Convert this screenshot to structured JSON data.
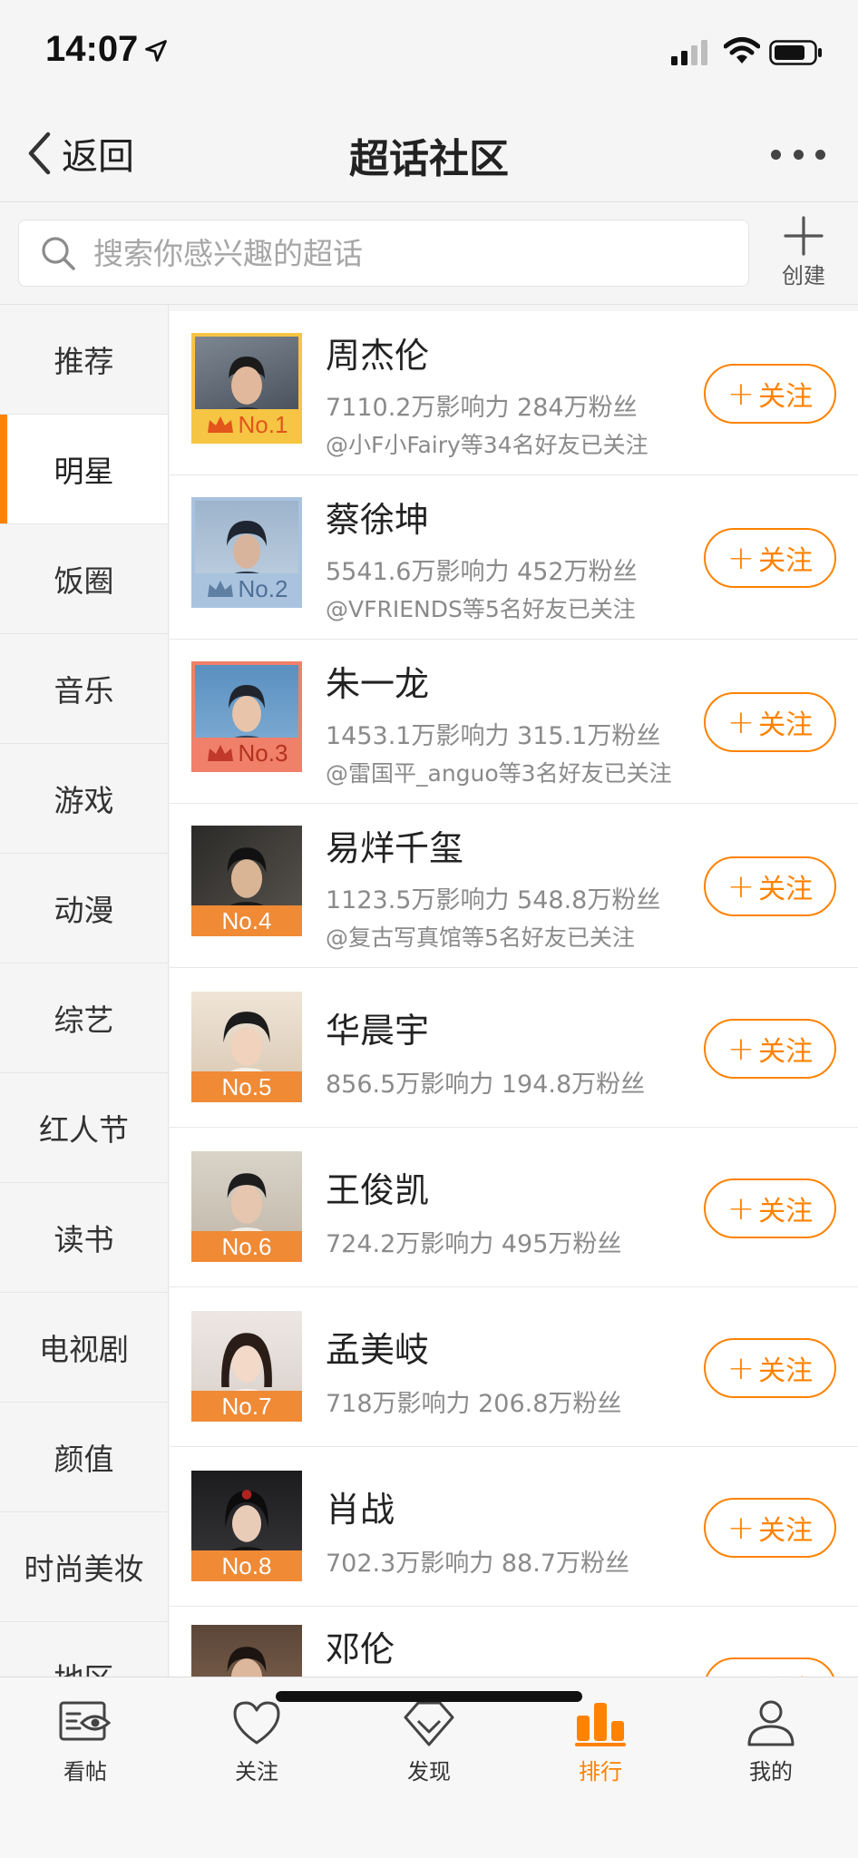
{
  "status_bar": {
    "time": "14:07"
  },
  "nav": {
    "back_label": "返回",
    "title": "超话社区"
  },
  "search": {
    "placeholder": "搜索你感兴趣的超话",
    "create_label": "创建"
  },
  "sidebar": {
    "items": [
      {
        "label": "推荐",
        "active": false
      },
      {
        "label": "明星",
        "active": true
      },
      {
        "label": "饭圈",
        "active": false
      },
      {
        "label": "音乐",
        "active": false
      },
      {
        "label": "游戏",
        "active": false
      },
      {
        "label": "动漫",
        "active": false
      },
      {
        "label": "综艺",
        "active": false
      },
      {
        "label": "红人节",
        "active": false
      },
      {
        "label": "读书",
        "active": false
      },
      {
        "label": "电视剧",
        "active": false
      },
      {
        "label": "颜值",
        "active": false
      },
      {
        "label": "时尚美妆",
        "active": false
      },
      {
        "label": "地区",
        "active": false
      }
    ]
  },
  "follow_label": "关注",
  "rank_colors": {
    "gold": "#f6c544",
    "silver": "#a9c3df",
    "bronze": "#f0806a",
    "default": "#f08a35"
  },
  "ranking": [
    {
      "rank": "No.1",
      "name": "周杰伦",
      "stats": "7110.2万影响力 284万粉丝",
      "friends": "@小F小Fairy等34名好友已关注",
      "tier": "gold"
    },
    {
      "rank": "No.2",
      "name": "蔡徐坤",
      "stats": "5541.6万影响力 452万粉丝",
      "friends": "@VFRIENDS等5名好友已关注",
      "tier": "silver"
    },
    {
      "rank": "No.3",
      "name": "朱一龙",
      "stats": "1453.1万影响力 315.1万粉丝",
      "friends": "@雷国平_anguo等3名好友已关注",
      "tier": "bronze"
    },
    {
      "rank": "No.4",
      "name": "易烊千玺",
      "stats": "1123.5万影响力 548.8万粉丝",
      "friends": "@复古写真馆等5名好友已关注",
      "tier": "default"
    },
    {
      "rank": "No.5",
      "name": "华晨宇",
      "stats": "856.5万影响力 194.8万粉丝",
      "friends": "",
      "tier": "default"
    },
    {
      "rank": "No.6",
      "name": "王俊凯",
      "stats": "724.2万影响力 495万粉丝",
      "friends": "",
      "tier": "default"
    },
    {
      "rank": "No.7",
      "name": "孟美岐",
      "stats": "718万影响力 206.8万粉丝",
      "friends": "",
      "tier": "default"
    },
    {
      "rank": "No.8",
      "name": "肖战",
      "stats": "702.3万影响力 88.7万粉丝",
      "friends": "",
      "tier": "default"
    },
    {
      "rank": "",
      "name": "邓伦",
      "stats": "",
      "friends": "",
      "tier": "default"
    }
  ],
  "tabs": [
    {
      "label": "看帖",
      "icon": "view-posts-icon",
      "active": false
    },
    {
      "label": "关注",
      "icon": "heart-icon",
      "active": false
    },
    {
      "label": "发现",
      "icon": "diamond-icon",
      "active": false
    },
    {
      "label": "排行",
      "icon": "ranking-bars-icon",
      "active": true
    },
    {
      "label": "我的",
      "icon": "profile-icon",
      "active": false
    }
  ]
}
